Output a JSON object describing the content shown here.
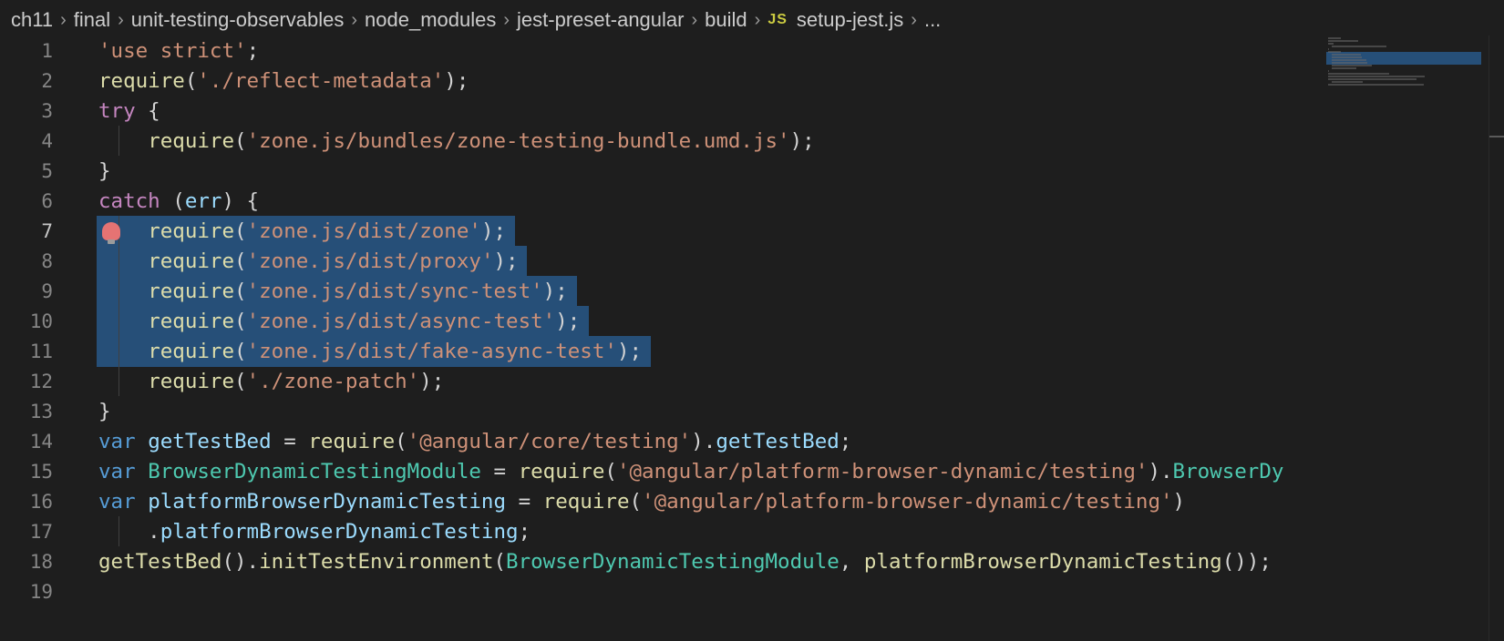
{
  "breadcrumb": {
    "items": [
      "ch11",
      "final",
      "unit-testing-observables",
      "node_modules",
      "jest-preset-angular",
      "build"
    ],
    "file_icon": "JS",
    "file_name": "setup-jest.js",
    "ellipsis": "..."
  },
  "editor": {
    "selection_lines": [
      7,
      8,
      9,
      10,
      11
    ],
    "lines": [
      {
        "num": "1",
        "tokens": [
          [
            "str",
            "'use strict'"
          ],
          [
            "pl",
            ";"
          ]
        ]
      },
      {
        "num": "2",
        "tokens": [
          [
            "fn",
            "require"
          ],
          [
            "pl",
            "("
          ],
          [
            "str",
            "'./reflect-metadata'"
          ],
          [
            "pl",
            ");"
          ]
        ]
      },
      {
        "num": "3",
        "tokens": [
          [
            "kw",
            "try"
          ],
          [
            "pl",
            " {"
          ]
        ]
      },
      {
        "num": "4",
        "tokens": [
          [
            "pl",
            "    "
          ],
          [
            "fn",
            "require"
          ],
          [
            "pl",
            "("
          ],
          [
            "str",
            "'zone.js/bundles/zone-testing-bundle.umd.js'"
          ],
          [
            "pl",
            ");"
          ]
        ]
      },
      {
        "num": "5",
        "tokens": [
          [
            "pl",
            "}"
          ]
        ]
      },
      {
        "num": "6",
        "tokens": [
          [
            "kw",
            "catch"
          ],
          [
            "pl",
            " ("
          ],
          [
            "id",
            "err"
          ],
          [
            "pl",
            ") {"
          ]
        ]
      },
      {
        "num": "7",
        "tokens": [
          [
            "pl",
            "    "
          ],
          [
            "fn",
            "require"
          ],
          [
            "pl",
            "("
          ],
          [
            "str",
            "'zone.js/dist/zone'"
          ],
          [
            "pl",
            ");"
          ]
        ]
      },
      {
        "num": "8",
        "tokens": [
          [
            "pl",
            "    "
          ],
          [
            "fn",
            "require"
          ],
          [
            "pl",
            "("
          ],
          [
            "str",
            "'zone.js/dist/proxy'"
          ],
          [
            "pl",
            ");"
          ]
        ]
      },
      {
        "num": "9",
        "tokens": [
          [
            "pl",
            "    "
          ],
          [
            "fn",
            "require"
          ],
          [
            "pl",
            "("
          ],
          [
            "str",
            "'zone.js/dist/sync-test'"
          ],
          [
            "pl",
            ");"
          ]
        ]
      },
      {
        "num": "10",
        "tokens": [
          [
            "pl",
            "    "
          ],
          [
            "fn",
            "require"
          ],
          [
            "pl",
            "("
          ],
          [
            "str",
            "'zone.js/dist/async-test'"
          ],
          [
            "pl",
            ");"
          ]
        ]
      },
      {
        "num": "11",
        "tokens": [
          [
            "pl",
            "    "
          ],
          [
            "fn",
            "require"
          ],
          [
            "pl",
            "("
          ],
          [
            "str",
            "'zone.js/dist/fake-async-test'"
          ],
          [
            "pl",
            ");"
          ]
        ]
      },
      {
        "num": "12",
        "tokens": [
          [
            "pl",
            "    "
          ],
          [
            "fn",
            "require"
          ],
          [
            "pl",
            "("
          ],
          [
            "str",
            "'./zone-patch'"
          ],
          [
            "pl",
            ");"
          ]
        ]
      },
      {
        "num": "13",
        "tokens": [
          [
            "pl",
            "}"
          ]
        ]
      },
      {
        "num": "14",
        "tokens": [
          [
            "var",
            "var"
          ],
          [
            "pl",
            " "
          ],
          [
            "id",
            "getTestBed"
          ],
          [
            "pl",
            " = "
          ],
          [
            "fn",
            "require"
          ],
          [
            "pl",
            "("
          ],
          [
            "str",
            "'@angular/core/testing'"
          ],
          [
            "pl",
            ")."
          ],
          [
            "id",
            "getTestBed"
          ],
          [
            "pl",
            ";"
          ]
        ]
      },
      {
        "num": "15",
        "tokens": [
          [
            "var",
            "var"
          ],
          [
            "pl",
            " "
          ],
          [
            "cls",
            "BrowserDynamicTestingModule"
          ],
          [
            "pl",
            " = "
          ],
          [
            "fn",
            "require"
          ],
          [
            "pl",
            "("
          ],
          [
            "str",
            "'@angular/platform-browser-dynamic/testing'"
          ],
          [
            "pl",
            ")."
          ],
          [
            "cls",
            "BrowserDy"
          ]
        ]
      },
      {
        "num": "16",
        "tokens": [
          [
            "var",
            "var"
          ],
          [
            "pl",
            " "
          ],
          [
            "id",
            "platformBrowserDynamicTesting"
          ],
          [
            "pl",
            " = "
          ],
          [
            "fn",
            "require"
          ],
          [
            "pl",
            "("
          ],
          [
            "str",
            "'@angular/platform-browser-dynamic/testing'"
          ],
          [
            "pl",
            ")"
          ]
        ]
      },
      {
        "num": "17",
        "tokens": [
          [
            "pl",
            "    ."
          ],
          [
            "id",
            "platformBrowserDynamicTesting"
          ],
          [
            "pl",
            ";"
          ]
        ]
      },
      {
        "num": "18",
        "tokens": [
          [
            "fn",
            "getTestBed"
          ],
          [
            "pl",
            "()."
          ],
          [
            "fn",
            "initTestEnvironment"
          ],
          [
            "pl",
            "("
          ],
          [
            "cls",
            "BrowserDynamicTestingModule"
          ],
          [
            "pl",
            ", "
          ],
          [
            "fn",
            "platformBrowserDynamicTesting"
          ],
          [
            "pl",
            "());"
          ]
        ]
      },
      {
        "num": "19",
        "tokens": []
      }
    ]
  },
  "colors": {
    "background": "#1e1e1e",
    "selection": "#264f78",
    "string": "#ce9178",
    "keyword": "#c586c0",
    "storage": "#569cd6",
    "function": "#dcdcaa",
    "class": "#4ec9b0",
    "identifier": "#9cdcfe"
  },
  "icons": {
    "breadcrumb_separator": "chevron-right-icon",
    "file_type": "javascript-file-icon",
    "code_action": "lightbulb-icon"
  }
}
